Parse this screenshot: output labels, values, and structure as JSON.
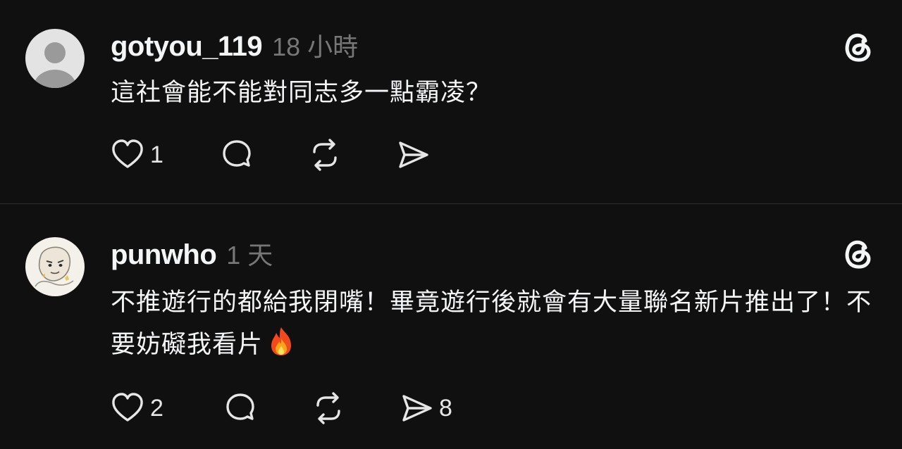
{
  "colors": {
    "background": "#101010",
    "text": "#f3f5f7",
    "muted": "#777777",
    "divider": "#2d2d2d"
  },
  "posts": [
    {
      "username": "gotyou_119",
      "time": "18 小時",
      "text": "這社會能不能對同志多一點霸凌？",
      "avatar_icon": "default-avatar-icon",
      "likes": "1",
      "replies": "",
      "reposts": "",
      "shares": ""
    },
    {
      "username": "punwho",
      "time": "1 天",
      "text": "不推遊行的都給我閉嘴！畢竟遊行後就會有大量聯名新片推出了！不要妨礙我看片",
      "text_emoji_icon": "fire-emoji-icon",
      "avatar_icon": "sketch-avatar-icon",
      "likes": "2",
      "replies": "",
      "reposts": "",
      "shares": "8"
    }
  ],
  "icons": {
    "like": "heart-icon",
    "reply": "comment-bubble-icon",
    "repost": "repost-icon",
    "share": "send-icon",
    "brand": "threads-logo-icon"
  }
}
